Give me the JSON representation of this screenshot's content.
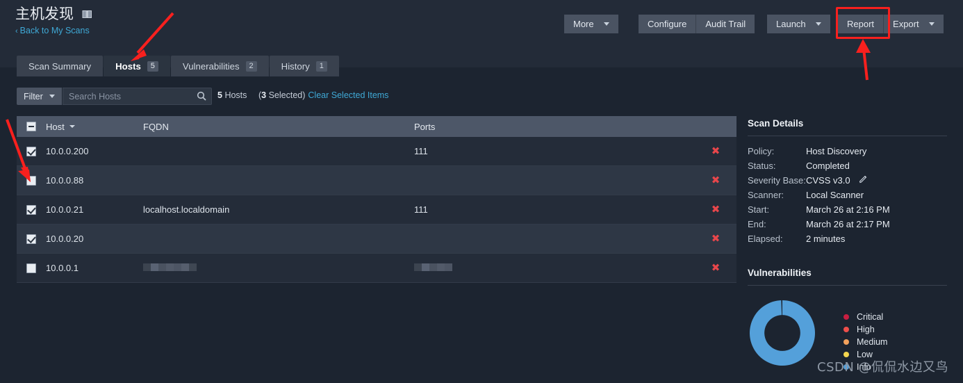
{
  "header": {
    "title": "主机发现",
    "title_icon": "book-icon",
    "back_link": "Back to My Scans",
    "back_chevron": "‹",
    "buttons": {
      "more": "More",
      "configure": "Configure",
      "audit_trail": "Audit Trail",
      "launch": "Launch",
      "report": "Report",
      "export": "Export"
    }
  },
  "tabs": [
    {
      "label": "Scan Summary",
      "count": "",
      "active": false
    },
    {
      "label": "Hosts",
      "count": "5",
      "active": true
    },
    {
      "label": "Vulnerabilities",
      "count": "2",
      "active": false
    },
    {
      "label": "History",
      "count": "1",
      "active": false
    }
  ],
  "filter_bar": {
    "filter_label": "Filter",
    "search_placeholder": "Search Hosts",
    "search_value": "",
    "search_icon": "search-icon",
    "host_count_number": "5",
    "host_count_label": "Hosts",
    "selected_prefix": "(",
    "selected_number": "3",
    "selected_suffix": " Selected)",
    "clear_selected": "Clear Selected Items"
  },
  "table": {
    "columns": [
      "Host",
      "FQDN",
      "Ports"
    ],
    "header_checkbox_state": "indeterminate",
    "sort_column": "Host",
    "rows": [
      {
        "checked": true,
        "host": "10.0.0.200",
        "fqdn": "",
        "ports": "111",
        "redacted": false,
        "delete_icon": "✖"
      },
      {
        "checked": false,
        "host": "10.0.0.88",
        "fqdn": "",
        "ports": "",
        "redacted": false,
        "delete_icon": "✖"
      },
      {
        "checked": true,
        "host": "10.0.0.21",
        "fqdn": "localhost.localdomain",
        "ports": "111",
        "redacted": false,
        "delete_icon": "✖"
      },
      {
        "checked": true,
        "host": "10.0.0.20",
        "fqdn": "",
        "ports": "",
        "redacted": false,
        "delete_icon": "✖"
      },
      {
        "checked": false,
        "host": "10.0.0.1",
        "fqdn": "",
        "ports": "",
        "redacted": true,
        "delete_icon": "✖"
      }
    ]
  },
  "scan_details": {
    "title": "Scan Details",
    "edit_icon": "pencil-icon",
    "fields": [
      {
        "key": "Policy:",
        "value": "Host Discovery"
      },
      {
        "key": "Status:",
        "value": "Completed"
      },
      {
        "key": "Severity Base:",
        "value": "CVSS v3.0",
        "editable": true
      },
      {
        "key": "Scanner:",
        "value": "Local Scanner"
      },
      {
        "key": "Start:",
        "value": "March 26 at 2:16 PM"
      },
      {
        "key": "End:",
        "value": "March 26 at 2:17 PM"
      },
      {
        "key": "Elapsed:",
        "value": "2 minutes"
      }
    ]
  },
  "vulnerabilities": {
    "title": "Vulnerabilities"
  },
  "chart_data": {
    "type": "pie",
    "title": "Vulnerabilities",
    "legend_position": "right",
    "categories": [
      "Critical",
      "High",
      "Medium",
      "Low",
      "Info"
    ],
    "values": [
      0,
      0,
      0,
      0,
      100
    ],
    "colors": [
      "#c81e41",
      "#ee4f4b",
      "#f2a15c",
      "#f4d64f",
      "#54a0da"
    ],
    "donut": true,
    "inner_radius_ratio": 0.55
  },
  "annotations": {
    "highlight_color": "#f8201e",
    "arrow_to_hosts_tab": "arrow-pointing-to-hosts-tab",
    "arrow_to_checkbox": "arrow-pointing-to-row-checkbox",
    "arrow_to_report": "arrow-pointing-to-report-button",
    "report_highlight_box": "red-rectangle-around-report-button"
  },
  "watermark": "CSDN @侃侃水边又鸟"
}
